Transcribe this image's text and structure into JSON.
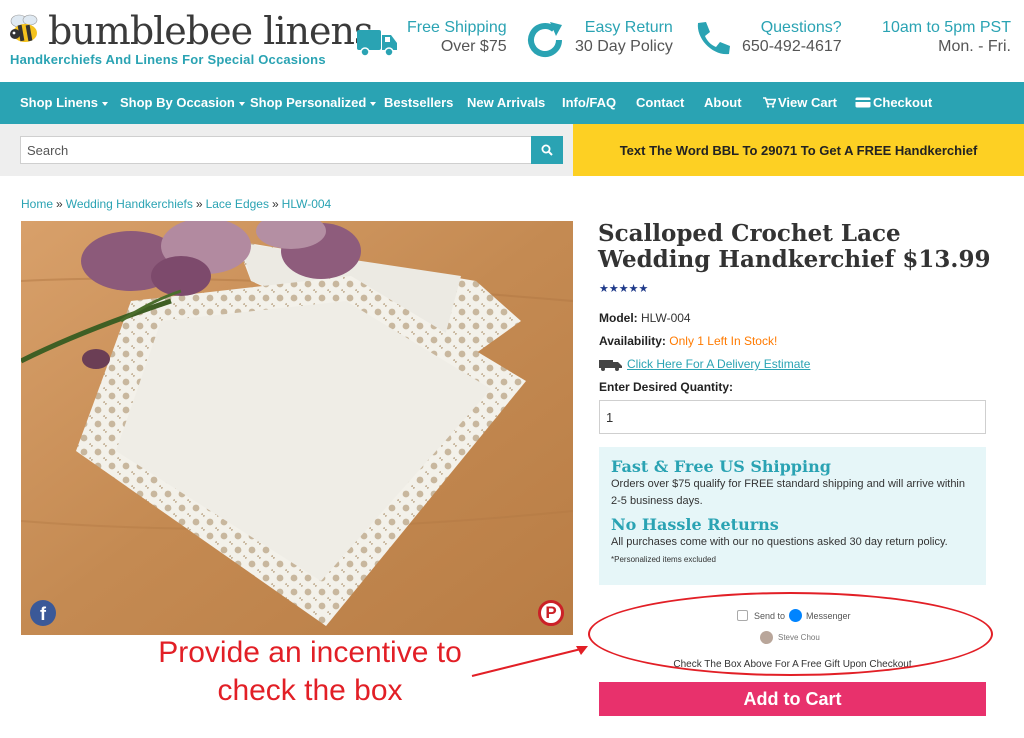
{
  "brand": {
    "name": "bumblebee linens",
    "tagline": "Handkerchiefs And Linens For Special Occasions"
  },
  "header_info": {
    "shipping": {
      "line1": "Free Shipping",
      "line2": "Over $75",
      "icon": "truck-icon"
    },
    "returns": {
      "line1": "Easy Return",
      "line2": "30 Day Policy",
      "icon": "return-arrow-icon"
    },
    "questions": {
      "line1": "Questions?",
      "line2": "650-492-4617",
      "icon": "phone-icon"
    },
    "hours": {
      "line1": "10am to 5pm PST",
      "line2": "Mon. - Fri."
    }
  },
  "nav": {
    "items": [
      {
        "label": "Shop Linens",
        "dropdown": true
      },
      {
        "label": "Shop By Occasion",
        "dropdown": true
      },
      {
        "label": "Shop Personalized",
        "dropdown": true
      },
      {
        "label": "Bestsellers",
        "dropdown": false
      },
      {
        "label": "New Arrivals",
        "dropdown": false
      },
      {
        "label": "Info/FAQ",
        "dropdown": false
      },
      {
        "label": "Contact",
        "dropdown": false
      },
      {
        "label": "About",
        "dropdown": false
      },
      {
        "label": "View Cart",
        "dropdown": false
      },
      {
        "label": "Checkout",
        "dropdown": false
      }
    ]
  },
  "search": {
    "placeholder": "Search"
  },
  "promo": {
    "text": "Text The Word BBL To 29071 To Get A FREE Handkerchief"
  },
  "breadcrumb": [
    "Home",
    "Wedding Handkerchiefs",
    "Lace Edges",
    "HLW-004"
  ],
  "product": {
    "title": "Scalloped Crochet Lace Wedding Handkerchief $13.99",
    "stars": "★★★★★",
    "model_label": "Model:",
    "model_value": "HLW-004",
    "availability_label": "Availability:",
    "availability_value": "Only 1 Left In Stock!",
    "delivery_link": "Click Here For A Delivery Estimate",
    "quantity_label": "Enter Desired Quantity:",
    "quantity_value": "1"
  },
  "shipping_box": {
    "heading1": "Fast & Free US Shipping",
    "text1": "Orders over $75 qualify for FREE standard shipping and will arrive within 2-5 business days.",
    "heading2": "No Hassle Returns",
    "text2": "All purchases come with our no questions asked 30 day return policy.",
    "footnote": "*Personalized items excluded"
  },
  "messenger": {
    "send_to": "Send to",
    "messenger": "Messenger",
    "user": "Steve Chou",
    "gift_note": "Check The Box Above For A Free Gift Upon Checkout"
  },
  "add_to_cart": "Add to Cart",
  "annotation": {
    "text": "Provide an incentive to check the box"
  },
  "colors": {
    "teal": "#2aa3b3",
    "yellow": "#fdd023",
    "pink": "#e8316c",
    "annotation_red": "#e21f26"
  }
}
